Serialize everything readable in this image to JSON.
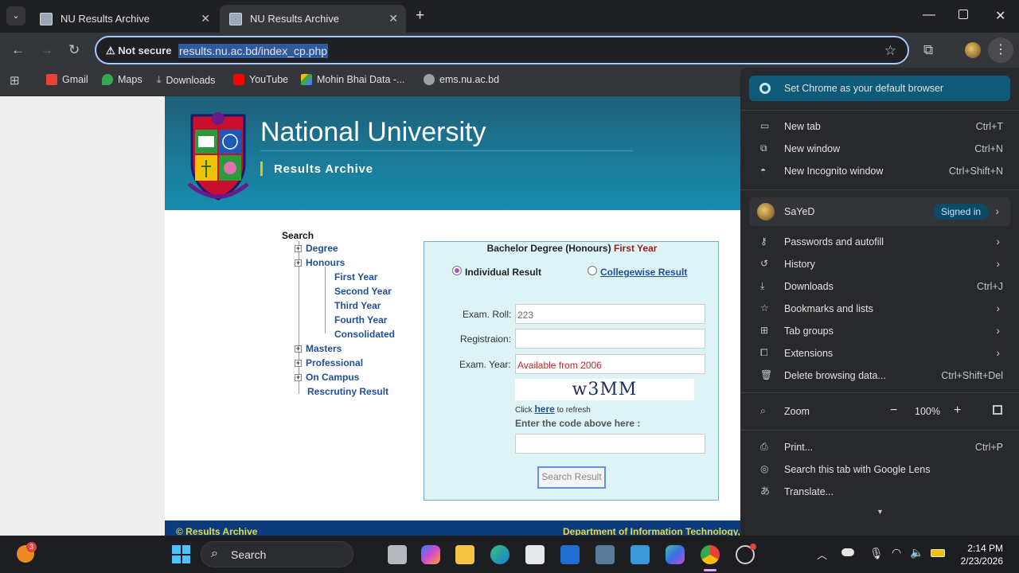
{
  "browser": {
    "tabs": [
      {
        "title": "NU Results Archive",
        "active": false
      },
      {
        "title": "NU Results Archive",
        "active": true
      }
    ],
    "security_label": "Not secure",
    "url": "results.nu.ac.bd/index_cp.php",
    "bookmarks": [
      {
        "label": "Gmail",
        "icon": "gmail-icon",
        "color": "#ea4335"
      },
      {
        "label": "Maps",
        "icon": "maps-icon",
        "color": "#34a853"
      },
      {
        "label": "Downloads",
        "icon": "download-icon",
        "color": "#c4c7c5"
      },
      {
        "label": "YouTube",
        "icon": "youtube-icon",
        "color": "#ff0000"
      },
      {
        "label": "Mohin Bhai Data -...",
        "icon": "drive-icon",
        "color": "#fbbc04"
      },
      {
        "label": "ems.nu.ac.bd",
        "icon": "globe-icon",
        "color": "#c4c7c5"
      }
    ]
  },
  "site": {
    "university": "National University",
    "subtitle": "Results Archive",
    "tree": {
      "root": "Search",
      "degree": "Degree",
      "honours": "Honours",
      "honours_children": [
        "First Year",
        "Second Year",
        "Third Year",
        "Fourth Year",
        "Consolidated"
      ],
      "masters": "Masters",
      "professional": "Professional",
      "on_campus": "On Campus",
      "rescrutiny": "Rescrutiny Result"
    },
    "form": {
      "title_main": "Bachelor Degree (Honours)",
      "title_year": "First Year",
      "radio_individual": "Individual Result",
      "radio_collegewise": "Collegewise Result",
      "roll_label": "Exam. Roll:",
      "roll_value": "223",
      "reg_label": "Registraion:",
      "reg_value": "",
      "year_label": "Exam. Year:",
      "year_value": "Available from 2006",
      "captcha": "w3MM",
      "refresh_prefix": "Click",
      "refresh_link": "here",
      "refresh_suffix": "to refresh",
      "code_label": "Enter the code above here :",
      "code_value": "",
      "search_button": "Search Result"
    },
    "footer_left": "© Results Archive",
    "footer_right": "Department of Information Technology,"
  },
  "menu": {
    "default_browser": "Set Chrome as your default browser",
    "new_tab": {
      "label": "New tab",
      "shortcut": "Ctrl+T"
    },
    "new_window": {
      "label": "New window",
      "shortcut": "Ctrl+N"
    },
    "incognito": {
      "label": "New Incognito window",
      "shortcut": "Ctrl+Shift+N"
    },
    "profile_name": "SaYeD",
    "signed_in": "Signed in",
    "passwords": "Passwords and autofill",
    "history": "History",
    "downloads": {
      "label": "Downloads",
      "shortcut": "Ctrl+J"
    },
    "bookmarks": "Bookmarks and lists",
    "tab_groups": "Tab groups",
    "extensions": "Extensions",
    "delete_data": {
      "label": "Delete browsing data...",
      "shortcut": "Ctrl+Shift+Del"
    },
    "zoom_label": "Zoom",
    "zoom_value": "100%",
    "print": {
      "label": "Print...",
      "shortcut": "Ctrl+P"
    },
    "lens": "Search this tab with Google Lens",
    "translate": "Translate..."
  },
  "taskbar": {
    "search_label": "Search",
    "notification_count": "3",
    "time": "2:14 PM",
    "date": "2/23/2026"
  }
}
